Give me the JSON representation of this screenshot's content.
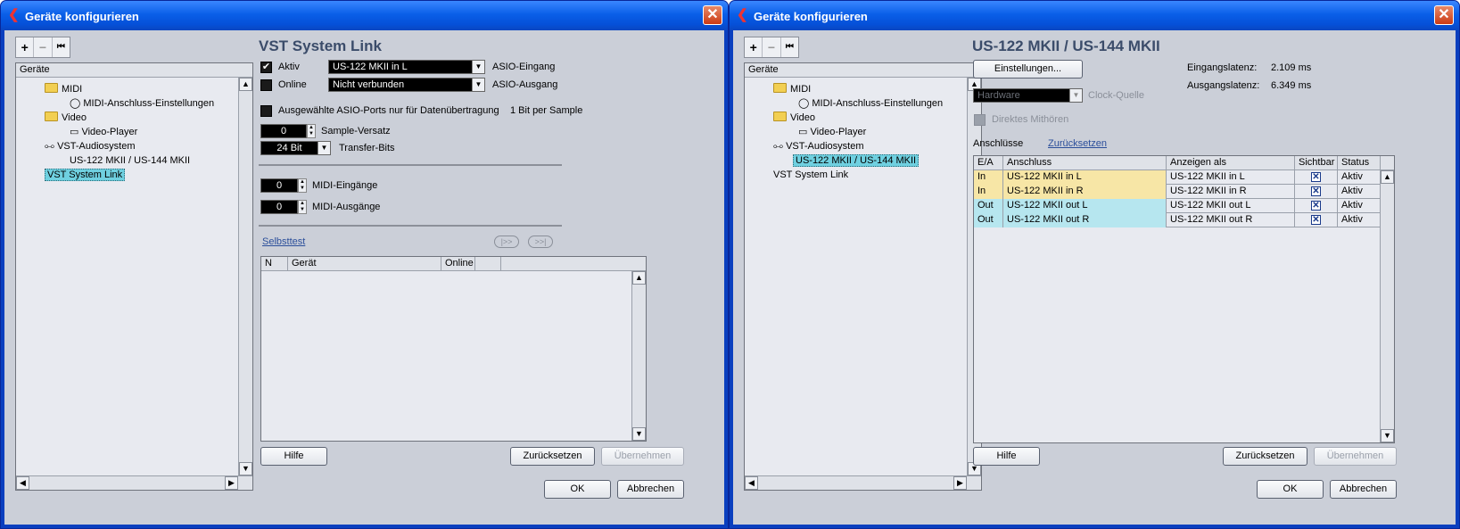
{
  "left": {
    "title": "Geräte konfigurieren",
    "tree_header": "Geräte",
    "tree": [
      "MIDI",
      "MIDI-Anschluss-Einstellungen",
      "Video",
      "Video-Player",
      "VST-Audiosystem",
      "US-122 MKII / US-144 MKII",
      "VST System Link"
    ],
    "heading": "VST System Link",
    "aktiv_label": "Aktiv",
    "aktiv_value": "US-122 MKII in L",
    "asio_in": "ASIO-Eingang",
    "online_label": "Online",
    "online_value": "Nicht verbunden",
    "asio_out": "ASIO-Ausgang",
    "asio_ports_label": "Ausgewählte ASIO-Ports nur für Datenübertragung",
    "bit_sample": "1 Bit per Sample",
    "sample_offset_value": "0",
    "sample_offset_label": "Sample-Versatz",
    "transfer_value": "24 Bit",
    "transfer_label": "Transfer-Bits",
    "midi_in_value": "0",
    "midi_in_label": "MIDI-Eingänge",
    "midi_out_value": "0",
    "midi_out_label": "MIDI-Ausgänge",
    "selftest": "Selbsttest",
    "cols": [
      "N",
      "Gerät",
      "Online"
    ],
    "help": "Hilfe",
    "reset": "Zurücksetzen",
    "apply": "Übernehmen",
    "ok": "OK",
    "cancel": "Abbrechen"
  },
  "right": {
    "title": "Geräte konfigurieren",
    "tree_header": "Geräte",
    "tree": [
      "MIDI",
      "MIDI-Anschluss-Einstellungen",
      "Video",
      "Video-Player",
      "VST-Audiosystem",
      "US-122 MKII / US-144 MKII",
      "VST System Link"
    ],
    "heading": "US-122 MKII / US-144 MKII",
    "settings": "Einstellungen...",
    "in_latency_label": "Eingangslatenz:",
    "in_latency": "2.109 ms",
    "out_latency_label": "Ausgangslatenz:",
    "out_latency": "6.349 ms",
    "clock_value": "Hardware",
    "clock_label": "Clock-Quelle",
    "monitor": "Direktes Mithören",
    "ports_label": "Anschlüsse",
    "ports_reset": "Zurücksetzen",
    "cols": [
      "E/A",
      "Anschluss",
      "Anzeigen als",
      "Sichtbar",
      "Status"
    ],
    "rows": [
      {
        "io": "In",
        "port": "US-122 MKII in L",
        "show": "US-122 MKII in L",
        "status": "Aktiv",
        "color": "#f7e6a6"
      },
      {
        "io": "In",
        "port": "US-122 MKII in R",
        "show": "US-122 MKII in R",
        "status": "Aktiv",
        "color": "#f7e6a6"
      },
      {
        "io": "Out",
        "port": "US-122 MKII out L",
        "show": "US-122 MKII out L",
        "status": "Aktiv",
        "color": "#b6e6ef"
      },
      {
        "io": "Out",
        "port": "US-122 MKII out R",
        "show": "US-122 MKII out R",
        "status": "Aktiv",
        "color": "#b6e6ef"
      }
    ],
    "help": "Hilfe",
    "reset": "Zurücksetzen",
    "apply": "Übernehmen",
    "ok": "OK",
    "cancel": "Abbrechen"
  }
}
